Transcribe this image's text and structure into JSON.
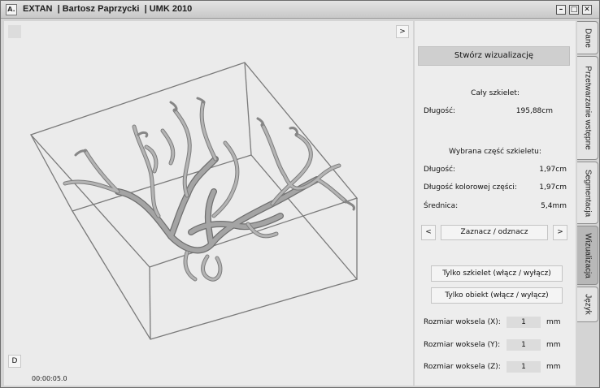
{
  "window": {
    "app_icon_text": "A.",
    "title": "EXTAN  | Bartosz Paprzycki  | UMK 2010",
    "minimize_label": "–",
    "maximize_label": "□",
    "close_label": "✕"
  },
  "viewport": {
    "expand_button": ">",
    "d_button": "D",
    "timer": "00:00:05.0"
  },
  "panel": {
    "create_button": "Stwórz wizualizację",
    "whole_skeleton_heading": "Cały szkielet:",
    "whole_length_label": "Długość:",
    "whole_length_value": "195,88cm",
    "selected_heading": "Wybrana część szkieletu:",
    "selected_length_label": "Długość:",
    "selected_length_value": "1,97cm",
    "colored_length_label": "Długość kolorowej części:",
    "colored_length_value": "1,97cm",
    "diameter_label": "Średnica:",
    "diameter_value": "5,4mm",
    "prev_button": "<",
    "toggle_select_button": "Zaznacz / odznacz",
    "next_button": ">",
    "skeleton_only_button": "Tylko szkielet (włącz / wyłącz)",
    "object_only_button": "Tylko obiekt (włącz / wyłącz)",
    "voxel_x_label": "Rozmiar woksela (X):",
    "voxel_x_value": "1",
    "voxel_y_label": "Rozmiar woksela (Y):",
    "voxel_y_value": "1",
    "voxel_z_label": "Rozmiar woksela (Z):",
    "voxel_z_value": "1",
    "unit": "mm"
  },
  "tabs": [
    {
      "label": "Dane",
      "active": false
    },
    {
      "label": "Przetwarzanie wstępne",
      "active": false
    },
    {
      "label": "Segmentacja",
      "active": false
    },
    {
      "label": "Wizualizacja",
      "active": true
    },
    {
      "label": "Język",
      "active": false
    }
  ],
  "colors": {
    "box": "#7a7a7a",
    "vessel": "#9a9a9a",
    "active_tab": "#b8b8b8"
  }
}
